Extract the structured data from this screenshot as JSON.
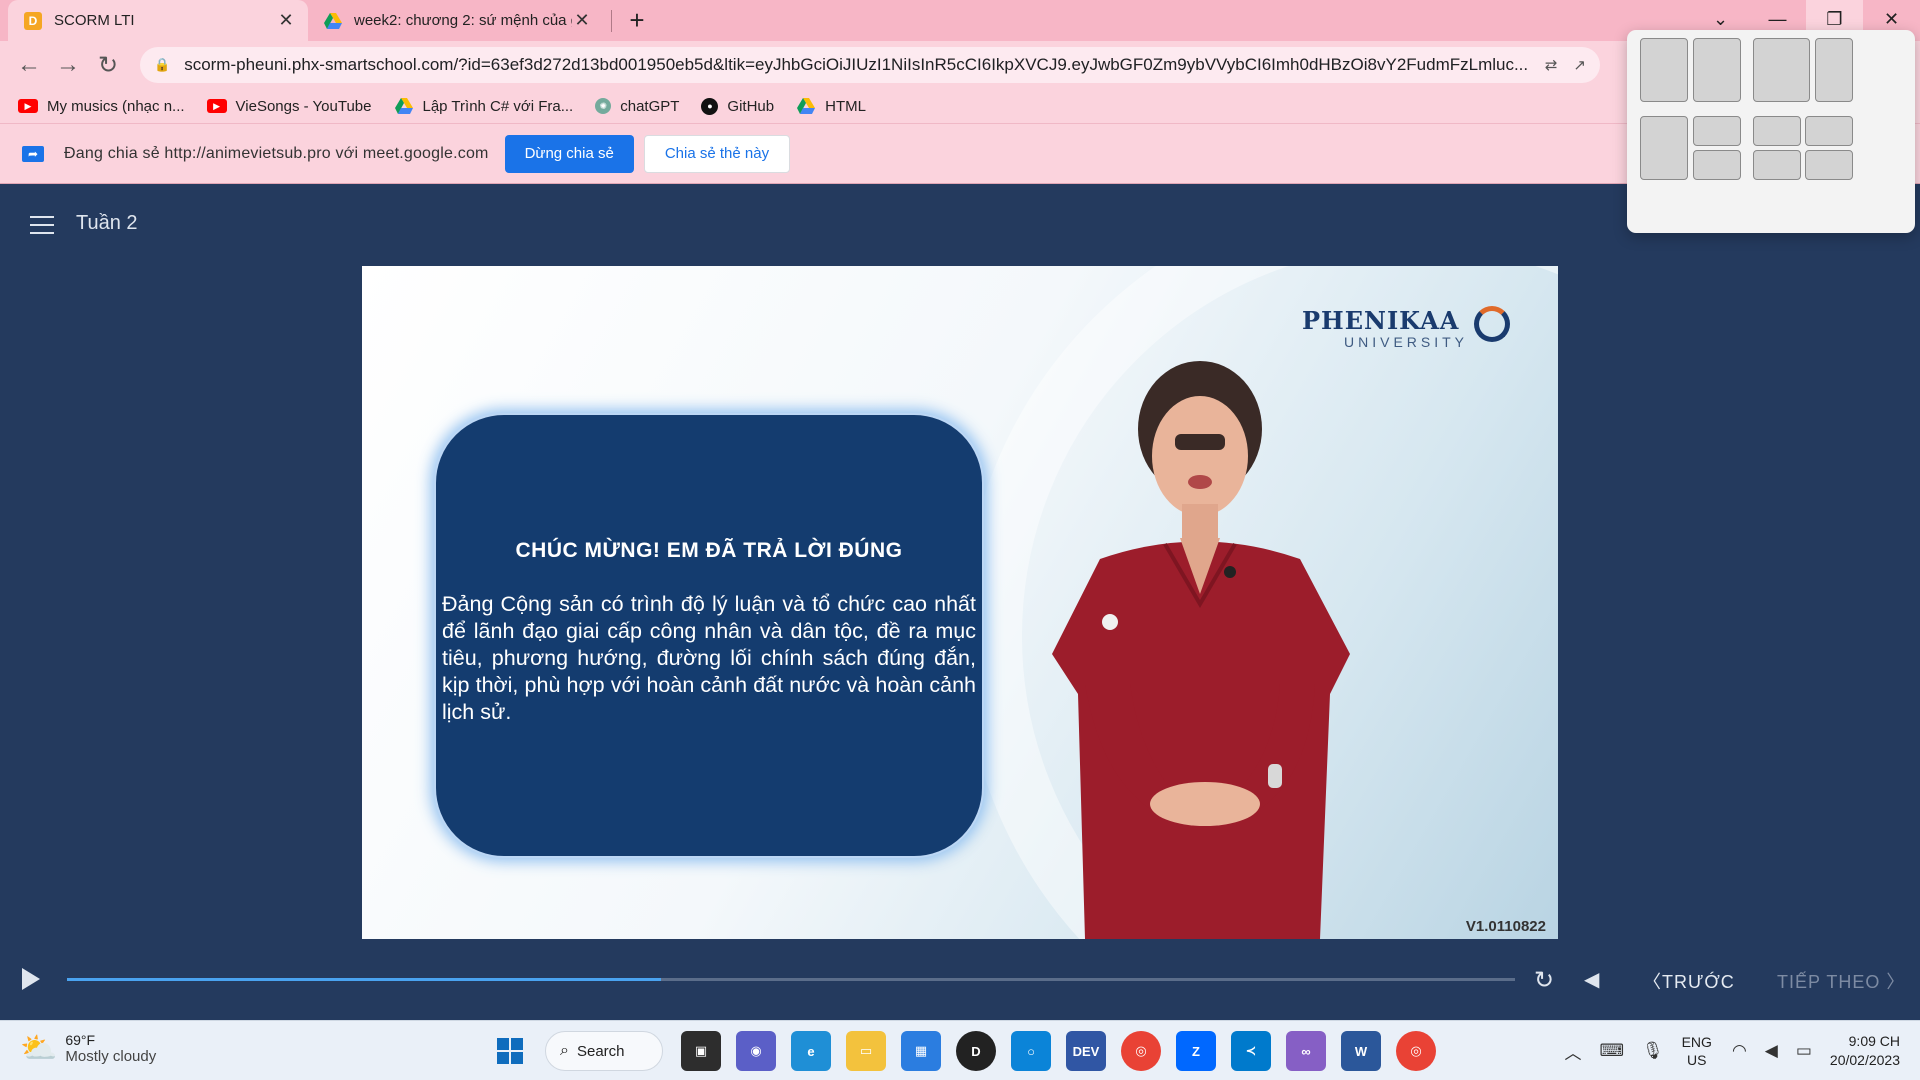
{
  "browser": {
    "tabs": [
      {
        "title": "SCORM LTI",
        "favicon_letter": "D",
        "active": true
      },
      {
        "title": "week2: chương 2: sứ mệnh của gi",
        "active": false
      }
    ],
    "url": "scorm-pheuni.phx-smartschool.com/?id=63ef3d272d13bd001950eb5d&ltik=eyJhbGciOiJIUzI1NiIsInR5cCI6IkpXVCJ9.eyJwbGF0Zm9ybVVybCI6Imh0dHBzOi8vY2FudmFzLmluc...",
    "bookmarks": [
      {
        "label": "My musics (nhạc n...",
        "icon": "youtube-icon"
      },
      {
        "label": "VieSongs - YouTube",
        "icon": "youtube-icon"
      },
      {
        "label": "Lập Trình C# với Fra...",
        "icon": "google-drive-icon"
      },
      {
        "label": "chatGPT",
        "icon": "openai-icon"
      },
      {
        "label": "GitHub",
        "icon": "github-icon"
      },
      {
        "label": "HTML",
        "icon": "google-drive-icon"
      }
    ],
    "share": {
      "text": "Đang chia sẻ http://animevietsub.pro với meet.google.com",
      "stop_label": "Dừng chia sẻ",
      "share_tab_label": "Chia sẻ thẻ này"
    }
  },
  "page": {
    "title": "Tuần 2"
  },
  "slide": {
    "logo_line1": "PHENIKAA",
    "logo_line2": "UNIVERSITY",
    "answer_heading": "CHÚC MỪNG! EM ĐÃ TRẢ LỜI ĐÚNG",
    "answer_body": "Đảng Cộng sản có trình độ lý luận và tổ chức cao nhất để lãnh đạo giai cấp công nhân và dân tộc, đề ra mục tiêu, phương hướng, đường lối chính sách đúng đắn, kịp thời, phù hợp với hoàn cảnh đất nước và hoàn cảnh lịch sử.",
    "version": "V1.0110822"
  },
  "player": {
    "progress": 0.41,
    "prev_label": "TRƯỚC",
    "next_label": "TIẾP THEO"
  },
  "taskbar": {
    "weather_temp": "69°F",
    "weather_desc": "Mostly cloudy",
    "search_label": "Search",
    "lang_line1": "ENG",
    "lang_line2": "US",
    "time": "9:09 CH",
    "date": "20/02/2023"
  },
  "colors": {
    "page_bg": "#243a5e",
    "answer_box": "#143c6f",
    "progress_fill": "#4aa3f0",
    "chrome_pink": "#fbd3dd"
  }
}
